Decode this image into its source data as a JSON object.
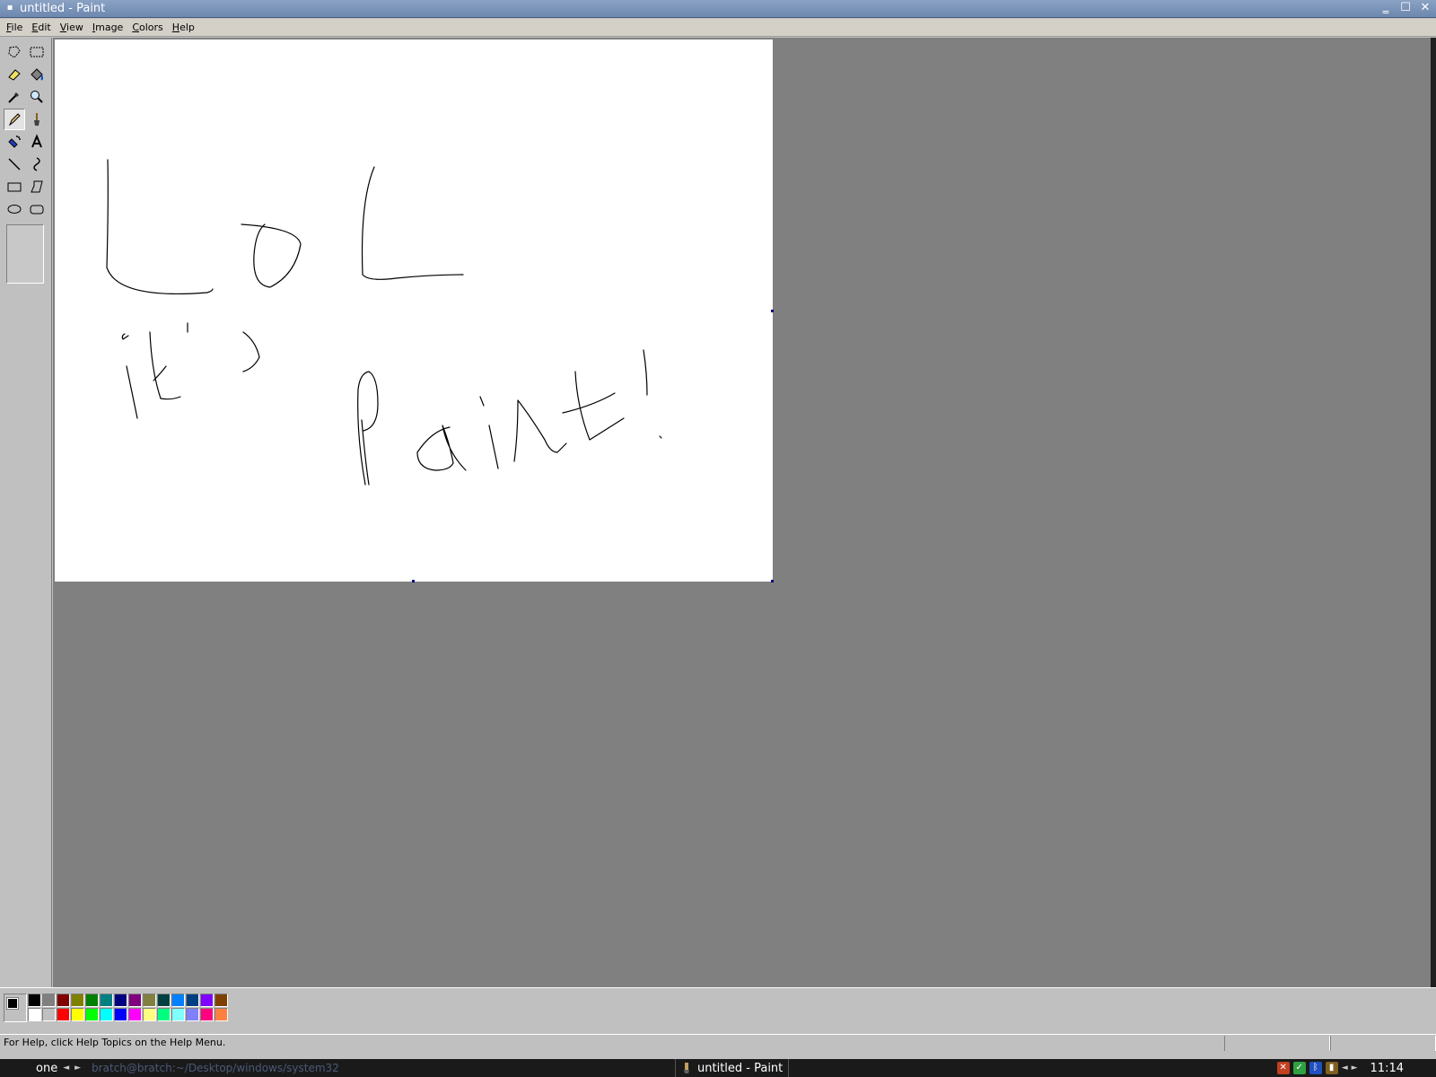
{
  "window": {
    "title": "untitled - Paint",
    "sys_glyph": "▪",
    "minimize_glyph": "‗",
    "maximize_glyph": "☐",
    "close_glyph": "✕"
  },
  "menu": [
    {
      "label_first": "F",
      "label_rest": "ile"
    },
    {
      "label_first": "E",
      "label_rest": "dit"
    },
    {
      "label_first": "V",
      "label_rest": "iew"
    },
    {
      "label_first": "I",
      "label_rest": "mage"
    },
    {
      "label_first": "C",
      "label_rest": "olors"
    },
    {
      "label_first": "H",
      "label_rest": "elp"
    }
  ],
  "tools": [
    {
      "name": "free-form-select-icon",
      "active": false
    },
    {
      "name": "rect-select-icon",
      "active": false
    },
    {
      "name": "eraser-icon",
      "active": false
    },
    {
      "name": "fill-bucket-icon",
      "active": false
    },
    {
      "name": "color-picker-icon",
      "active": false
    },
    {
      "name": "magnifier-icon",
      "active": false
    },
    {
      "name": "pencil-icon",
      "active": true
    },
    {
      "name": "brush-icon",
      "active": false
    },
    {
      "name": "airbrush-icon",
      "active": false
    },
    {
      "name": "text-icon",
      "active": false
    },
    {
      "name": "line-icon",
      "active": false
    },
    {
      "name": "curve-icon",
      "active": false
    },
    {
      "name": "rectangle-icon",
      "active": false
    },
    {
      "name": "polygon-icon",
      "active": false
    },
    {
      "name": "ellipse-icon",
      "active": false
    },
    {
      "name": "rounded-rect-icon",
      "active": false
    }
  ],
  "colors": {
    "foreground": "#000000",
    "background": "#ffffff",
    "palette_top": [
      "#000000",
      "#808080",
      "#800000",
      "#808000",
      "#008000",
      "#008080",
      "#000080",
      "#800080",
      "#808040",
      "#004040",
      "#0080ff",
      "#004080",
      "#8000ff",
      "#804000"
    ],
    "palette_bottom": [
      "#ffffff",
      "#c0c0c0",
      "#ff0000",
      "#ffff00",
      "#00ff00",
      "#00ffff",
      "#0000ff",
      "#ff00ff",
      "#ffff80",
      "#00ff80",
      "#80ffff",
      "#8080ff",
      "#ff0080",
      "#ff8040"
    ]
  },
  "status": {
    "help_text": "For Help, click Help Topics on the Help Menu."
  },
  "taskbar": {
    "workspace": "one",
    "prev_glyph": "◄",
    "next_glyph": "►",
    "path_text": "bratch@bratch:~/Desktop/windows/system32",
    "window_label": "untitled - Paint",
    "clock": "11:14"
  }
}
